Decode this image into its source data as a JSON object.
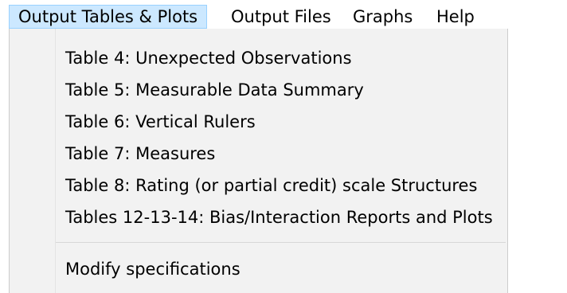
{
  "menubar": {
    "items": [
      {
        "label": "Output Tables & Plots",
        "active": true
      },
      {
        "label": "Output Files"
      },
      {
        "label": "Graphs"
      },
      {
        "label": "Help"
      }
    ]
  },
  "dropdown": {
    "items": [
      {
        "label": "Table 4: Unexpected Observations"
      },
      {
        "label": "Table 5: Measurable Data Summary"
      },
      {
        "label": "Table 6: Vertical Rulers"
      },
      {
        "label": "Table 7: Measures"
      },
      {
        "label": "Table 8: Rating (or partial credit) scale Structures"
      },
      {
        "label": "Tables 12-13-14: Bias/Interaction Reports and Plots"
      },
      {
        "label": "Modify specifications"
      }
    ]
  },
  "colors": {
    "active_menu_bg": "#cce8ff",
    "active_menu_border": "#99d1ff",
    "dropdown_bg": "#f2f2f2"
  }
}
